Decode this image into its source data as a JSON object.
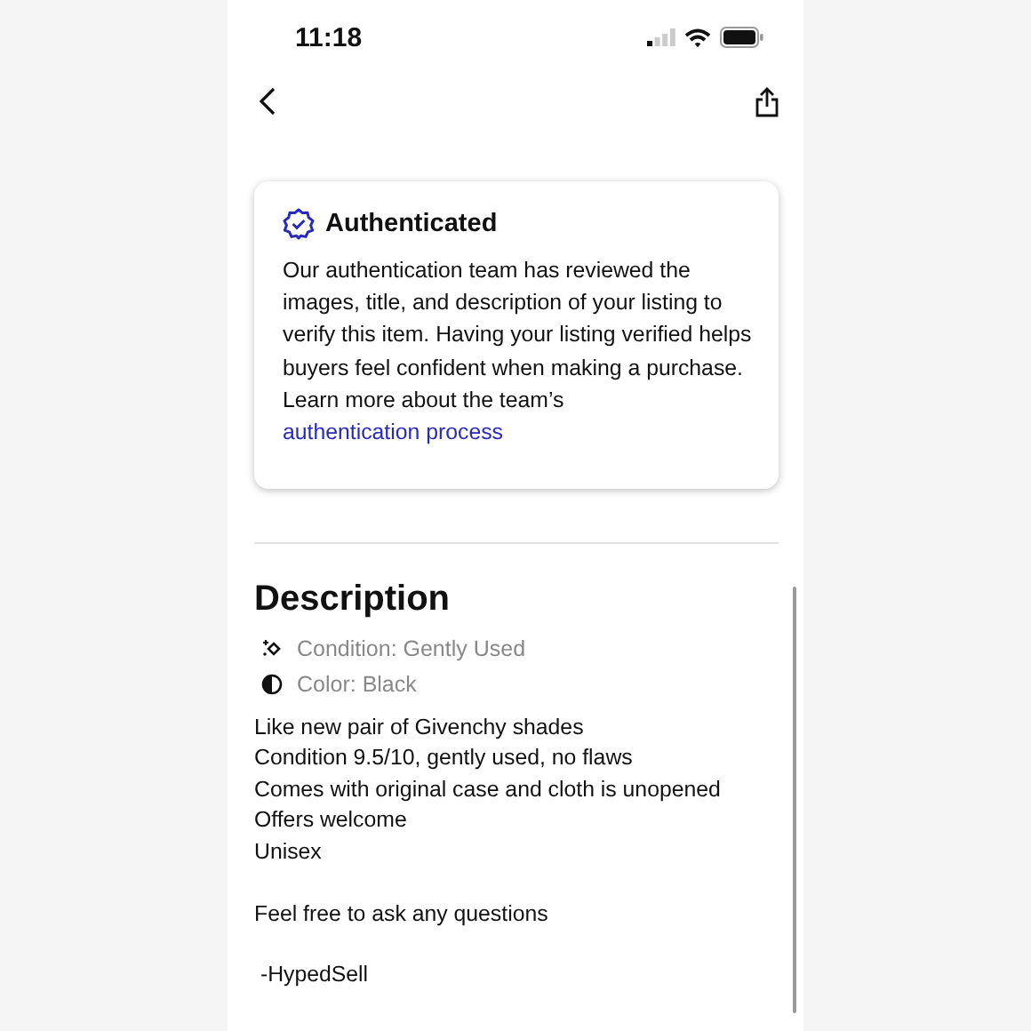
{
  "status_bar": {
    "time": "11:18"
  },
  "auth_card": {
    "title": "Authenticated",
    "text": "Our authentication team has reviewed the images, title, and description of your listing to verify this item. Having your listing verified helps buyers feel confident when making a purchase. Learn more about the team’s",
    "link": "authentication process"
  },
  "description": {
    "title": "Description",
    "attributes": [
      {
        "kind": "condition",
        "text": "Condition: Gently Used"
      },
      {
        "kind": "color",
        "text": "Color: Black"
      }
    ],
    "paragraphs": [
      [
        "Like new pair of Givenchy shades",
        "Condition 9.5/10, gently used, no flaws",
        "Comes with original case and cloth is unopened",
        "Offers welcome",
        "Unisex"
      ],
      [
        "Feel free to ask any questions"
      ],
      [
        " -HypedSell"
      ]
    ]
  }
}
